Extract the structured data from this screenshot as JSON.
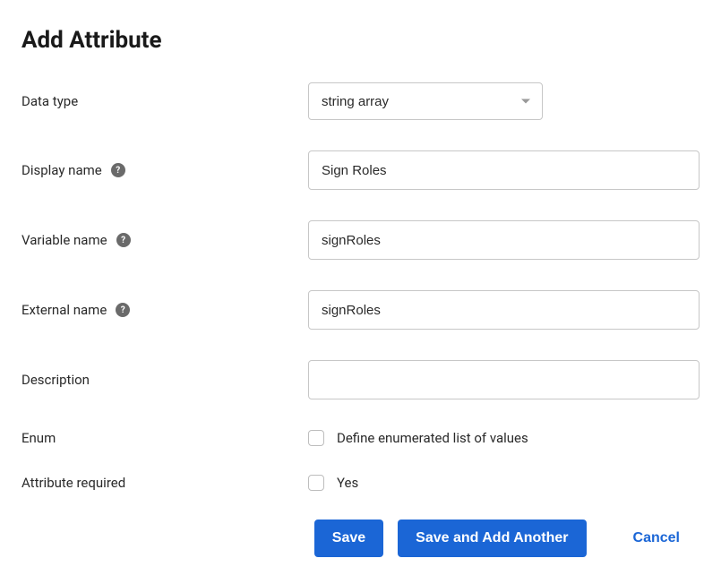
{
  "title": "Add Attribute",
  "form": {
    "data_type": {
      "label": "Data type",
      "value": "string array"
    },
    "display_name": {
      "label": "Display name",
      "value": "Sign Roles"
    },
    "variable_name": {
      "label": "Variable name",
      "value": "signRoles"
    },
    "external_name": {
      "label": "External name",
      "value": "signRoles"
    },
    "description": {
      "label": "Description",
      "value": ""
    },
    "enum": {
      "label": "Enum",
      "checkbox_label": "Define enumerated list of values",
      "checked": false
    },
    "required": {
      "label": "Attribute required",
      "checkbox_label": "Yes",
      "checked": false
    }
  },
  "buttons": {
    "save": "Save",
    "save_add": "Save and Add Another",
    "cancel": "Cancel"
  },
  "help_glyph": "?"
}
